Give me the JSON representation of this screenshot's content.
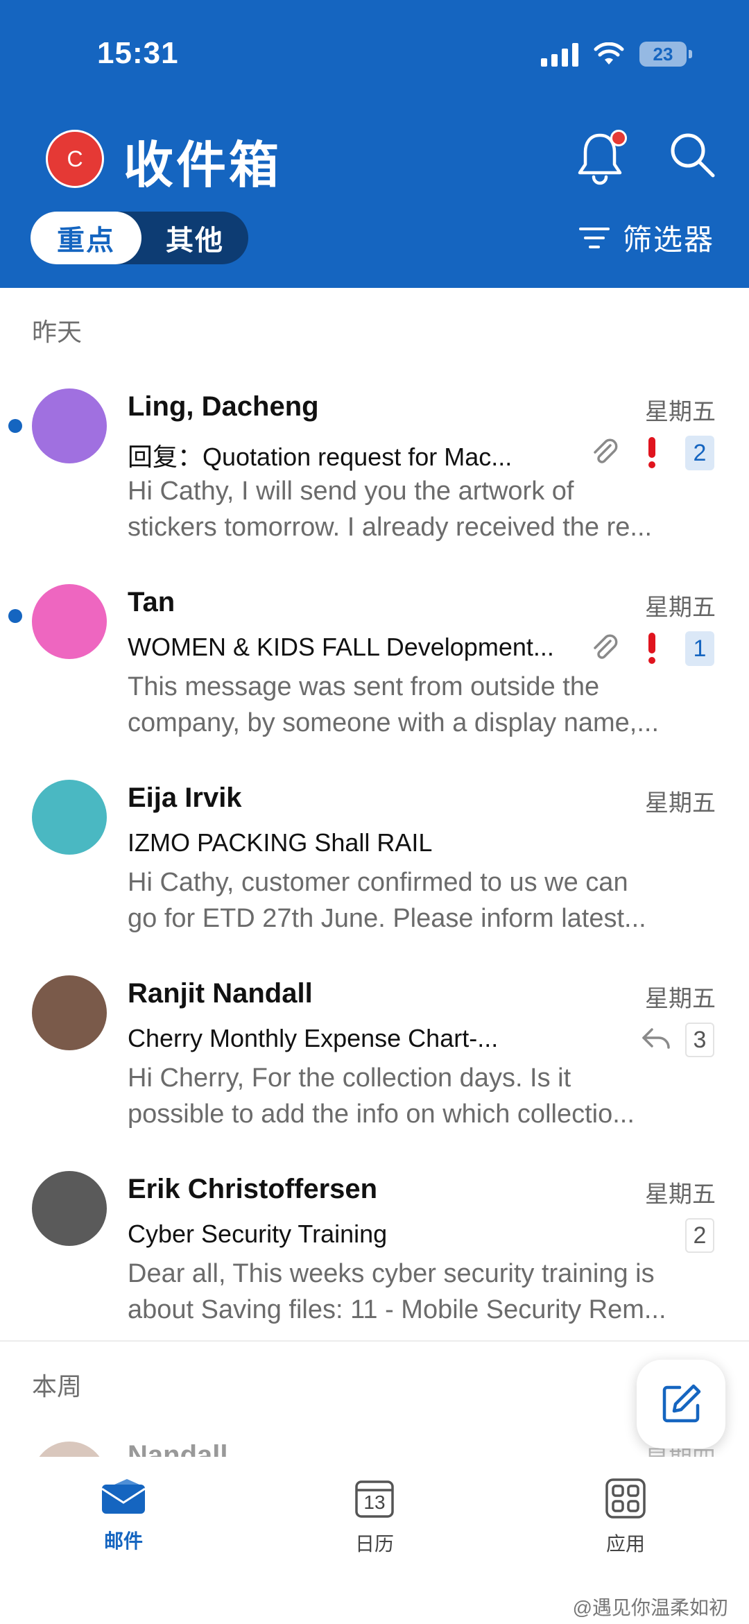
{
  "status_bar": {
    "time": "15:31",
    "battery": "23"
  },
  "header": {
    "account_initial": "C",
    "title": "收件箱",
    "tabs": [
      {
        "label": "重点",
        "active": true
      },
      {
        "label": "其他",
        "active": false
      }
    ],
    "filter_label": "筛选器"
  },
  "sections": {
    "yesterday": "昨天",
    "this_week": "本周"
  },
  "mails": [
    {
      "sender": "Ling, Dacheng",
      "date": "星期五",
      "subject": "回复：Quotation request for Mac...",
      "preview": [
        "Hi Cathy, I will send you the artwork of",
        "stickers tomorrow. I already received the re..."
      ],
      "count": "2",
      "unread": true,
      "attachment": true,
      "important": true,
      "replied": false,
      "avatar_color": "#a070e0"
    },
    {
      "sender": "Tan",
      "date": "星期五",
      "subject": "WOMEN & KIDS FALL Development...",
      "preview": [
        "This message was sent from outside the",
        "company, by someone with a display name,..."
      ],
      "count": "1",
      "unread": true,
      "attachment": true,
      "important": true,
      "replied": false,
      "avatar_color": "#ee66c0"
    },
    {
      "sender": "Eija Irvik",
      "date": "星期五",
      "subject": "IZMO PACKING Shall RAIL",
      "preview": [
        "Hi Cathy, customer confirmed to us we can",
        "go for ETD 27th June. Please inform latest..."
      ],
      "count": "",
      "unread": false,
      "attachment": false,
      "important": false,
      "replied": false,
      "avatar_color": "#4ab8c2"
    },
    {
      "sender": "Ranjit Nandall",
      "date": "星期五",
      "subject": "Cherry Monthly Expense Chart-...",
      "preview": [
        "Hi Cherry, For the collection days. Is it",
        "possible to add the info on which collectio..."
      ],
      "count": "3",
      "unread": false,
      "attachment": false,
      "important": false,
      "replied": true,
      "avatar_color": "#7a5a4a"
    },
    {
      "sender": "Erik Christoffersen",
      "date": "星期五",
      "subject": "Cyber Security Training",
      "preview": [
        "Dear all, This weeks cyber security training is",
        "about Saving files: 11 - Mobile Security Rem..."
      ],
      "count": "2",
      "unread": false,
      "attachment": false,
      "important": false,
      "replied": false,
      "avatar_color": "#5a5a5a"
    }
  ],
  "partial_mail": {
    "sender": "Nandall",
    "date": "星期四"
  },
  "bottom_nav": [
    {
      "label": "邮件",
      "icon": "mail-icon",
      "active": true
    },
    {
      "label": "日历",
      "icon": "calendar-icon",
      "calendar_day": "13",
      "active": false
    },
    {
      "label": "应用",
      "icon": "apps-icon",
      "active": false
    }
  ],
  "watermark": "@遇见你温柔如初",
  "colors": {
    "brand": "#1565c0",
    "important": "#e0141e",
    "unread": "#1565c0"
  }
}
